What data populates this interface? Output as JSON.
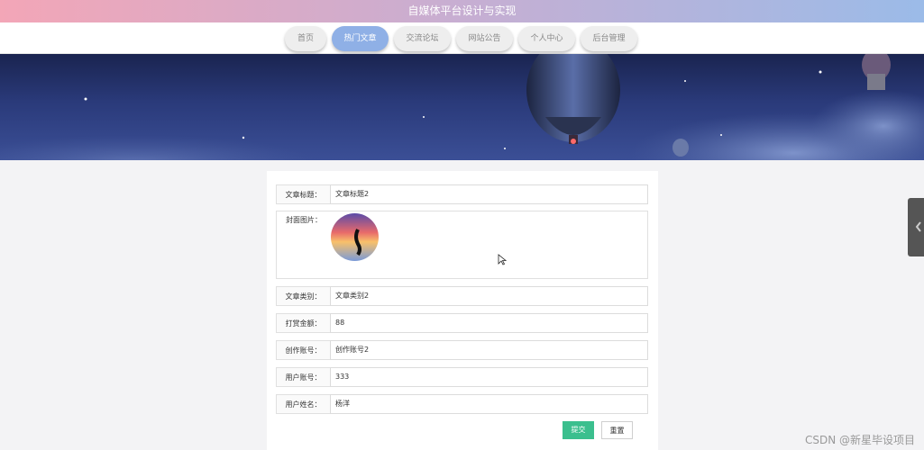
{
  "app": {
    "title": "自媒体平台设计与实现"
  },
  "nav": {
    "tabs": [
      {
        "label": "首页"
      },
      {
        "label": "热门文章"
      },
      {
        "label": "交流论坛"
      },
      {
        "label": "网站公告"
      },
      {
        "label": "个人中心"
      },
      {
        "label": "后台管理"
      }
    ],
    "active_index": 1
  },
  "form": {
    "title_label": "文章标题：",
    "title_value": "文章标题2",
    "cover_label": "封面图片：",
    "category_label": "文章类别：",
    "category_value": "文章类别2",
    "reward_label": "打赏金额：",
    "reward_value": "88",
    "creator_label": "创作账号：",
    "creator_value": "创作账号2",
    "user_account_label": "用户账号：",
    "user_account_value": "333",
    "user_name_label": "用户姓名：",
    "user_name_value": "杨洋",
    "submit_label": "提交",
    "reset_label": "重置"
  },
  "watermark": "CSDN @新星毕设项目",
  "colors": {
    "title_gradient_start": "#f3a6b7",
    "title_gradient_end": "#9bbbe8",
    "active_tab": "#8fb0e6",
    "submit": "#3bbf8e"
  }
}
